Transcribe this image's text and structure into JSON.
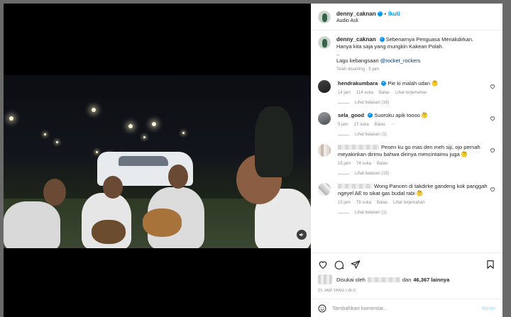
{
  "header": {
    "username": "denny_caknan",
    "follow_label": "Ikuti",
    "audio": "Audio Asli"
  },
  "caption": {
    "username": "denny_caknan",
    "line1": "Sebenarnya Penguasa Menakdirkan.",
    "line2": "Hanya kita saja yang mungkin Kakean Polah.",
    "line3": "..",
    "song_prefix": "Lagu kebangsaan",
    "song_link": "@rocket_rockers",
    "edited": "Telah disunting · 5 jam"
  },
  "comments": [
    {
      "username": "hendrakumbara",
      "text": "Pie ki malah udan 🤔",
      "time": "14 jam",
      "likes": "114 suka",
      "reply": "Balas",
      "translate": "Lihat terjemahan",
      "replies": "Lihat balasan (16)"
    },
    {
      "username": "sela_good",
      "text": "Suoroku apik toooo 🤔",
      "time": "5 jam",
      "likes": "17 suka",
      "reply": "Balas",
      "replies": "Lihat balasan (1)"
    },
    {
      "text_line1": "Pesen ku go mas den meh siji, ojo pernah",
      "text_line2": "meyakinkan dirimu bahwa dirinya mencintaimu juga 🤔",
      "time": "15 jam",
      "likes": "74 suka",
      "reply": "Balas",
      "replies": "Lihat balasan (15)"
    },
    {
      "text_line1": "Wong Pancen di takdirke gandeng kok panggah",
      "text_line2": "ngeyel AE to sikat gas budal rabi 🤔",
      "time": "15 jam",
      "likes": "78 suka",
      "reply": "Balas",
      "translate": "Lihat terjemahan",
      "replies": "Lihat balasan (1)"
    }
  ],
  "likes": {
    "prefix": "Disukai oleh",
    "and": "dan",
    "count": "46,367 lainnya"
  },
  "time_ago": "15 JAM YANG LALU",
  "add_comment": {
    "placeholder": "Tambahkan komentar...",
    "post_label": "Kirim"
  },
  "colors": {
    "accent": "#0095f6",
    "link": "#00376b",
    "muted": "#8e8e8e"
  }
}
